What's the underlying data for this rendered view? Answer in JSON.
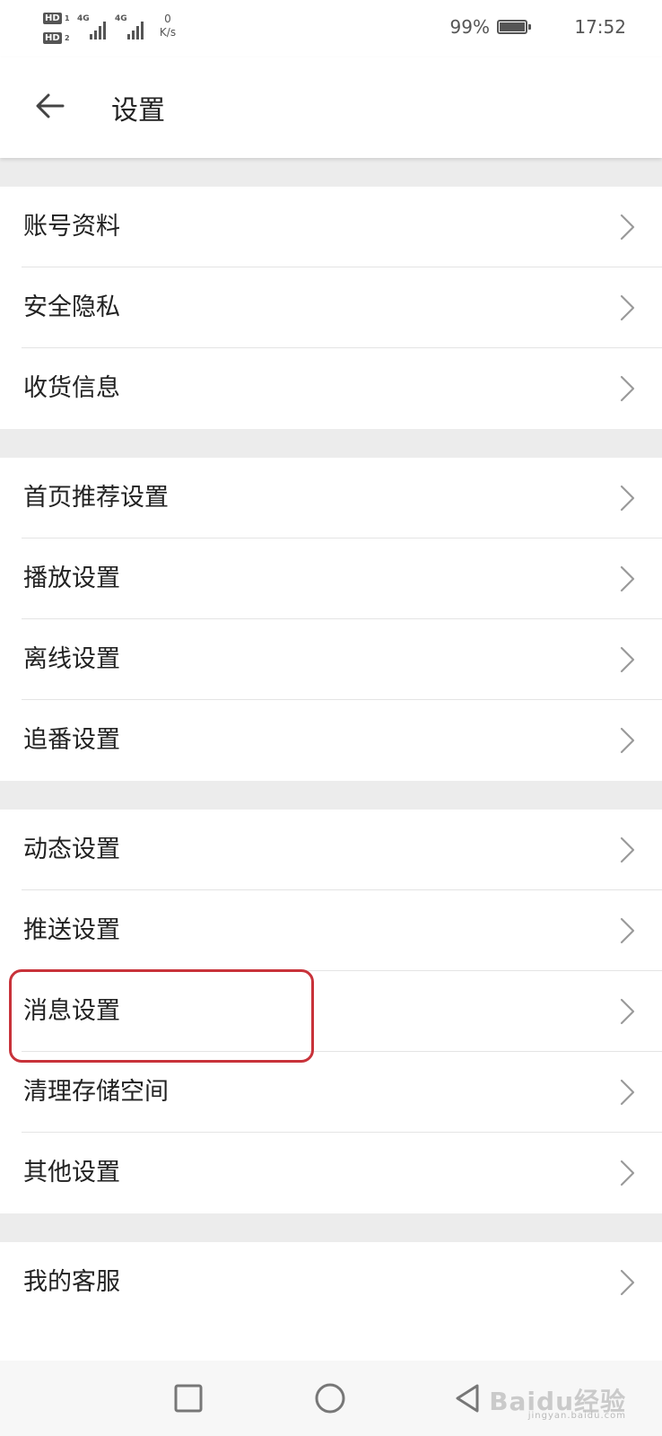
{
  "status_bar": {
    "sim1": "HD",
    "sim1_num": "1",
    "sim2": "HD",
    "sim2_num": "2",
    "network1": "4G",
    "network2": "4G",
    "speed_value": "0",
    "speed_unit": "K/s",
    "battery_percent": "99%",
    "battery_level": 0.99,
    "time": "17:52"
  },
  "header": {
    "title": "设置",
    "back_icon": "arrow-left-icon"
  },
  "sections": [
    {
      "items": [
        "账号资料",
        "安全隐私",
        "收货信息"
      ]
    },
    {
      "items": [
        "首页推荐设置",
        "播放设置",
        "离线设置",
        "追番设置"
      ]
    },
    {
      "items": [
        "动态设置",
        "推送设置",
        "消息设置",
        "清理存储空间",
        "其他设置"
      ]
    },
    {
      "items": [
        "我的客服"
      ]
    }
  ],
  "highlighted_item": "消息设置",
  "highlight_color": "#c8323a",
  "chevron_icon": "chevron-right-icon",
  "nav_bar": {
    "recent_icon": "square-icon",
    "home_icon": "circle-icon",
    "back_icon": "triangle-back-icon"
  },
  "watermark": {
    "text": "Baidu经验",
    "url_text": "jingyan.baidu.com"
  }
}
